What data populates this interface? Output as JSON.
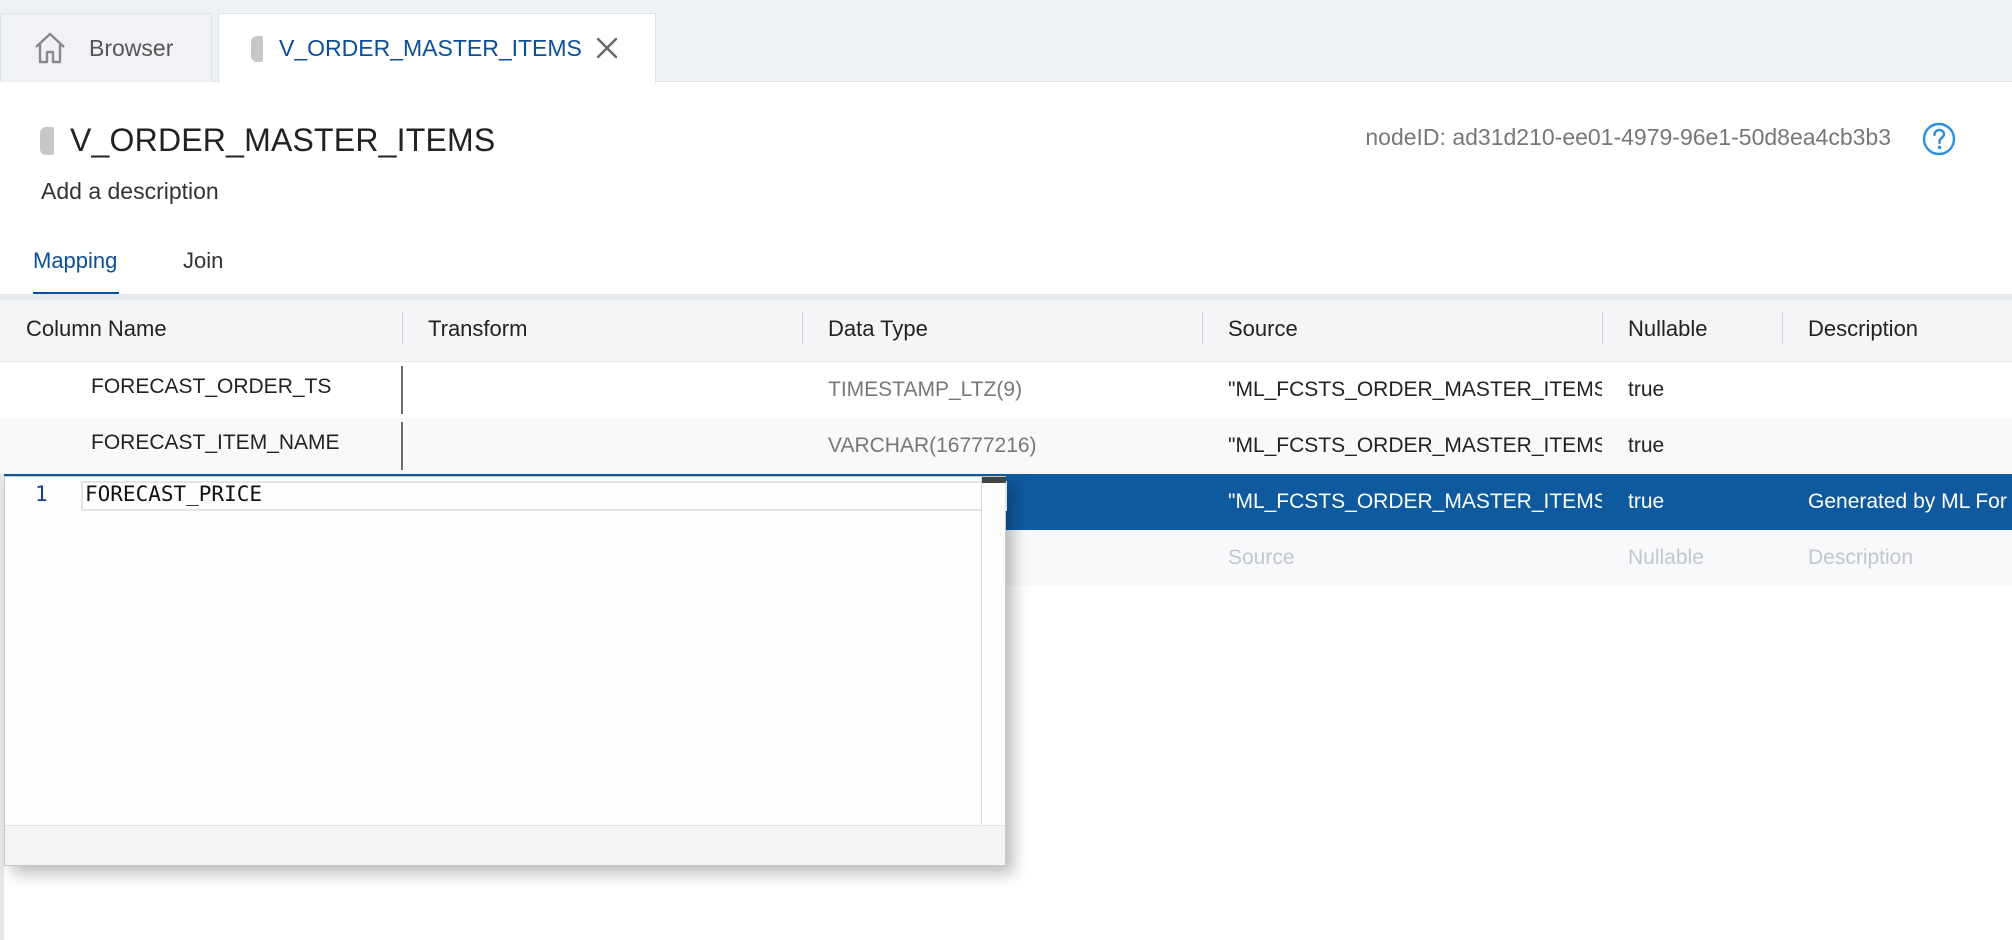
{
  "tabs": {
    "browser": {
      "label": "Browser",
      "icon": "home-icon"
    },
    "active": {
      "label": "V_ORDER_MASTER_ITEMS",
      "icon": "node-icon",
      "close_icon": "close-icon"
    }
  },
  "header": {
    "title": "V_ORDER_MASTER_ITEMS",
    "node_id": "nodeID: ad31d210-ee01-4979-96e1-50d8ea4cb3b3",
    "description_placeholder": "Add a description",
    "help_icon": "help-icon"
  },
  "subtabs": [
    {
      "label": "Mapping",
      "active": true
    },
    {
      "label": "Join",
      "active": false
    }
  ],
  "grid": {
    "columns": [
      "Column Name",
      "Transform",
      "Data Type",
      "Source",
      "Nullable",
      "Description"
    ],
    "rows": [
      {
        "name": "FORECAST_ORDER_TS",
        "transform": "",
        "data_type": "TIMESTAMP_LTZ(9)",
        "source": "\"ML_FCSTS_ORDER_MASTER_ITEMS\".",
        "nullable": "true",
        "description": ""
      },
      {
        "name": "FORECAST_ITEM_NAME",
        "transform": "",
        "data_type": "VARCHAR(16777216)",
        "source": "\"ML_FCSTS_ORDER_MASTER_ITEMS\".",
        "nullable": "true",
        "description": ""
      },
      {
        "name": "",
        "transform": "",
        "data_type": "",
        "source": "\"ML_FCSTS_ORDER_MASTER_ITEMS\".",
        "nullable": "true",
        "description": "Generated by ML For",
        "selected": true
      }
    ],
    "new_row_placeholders": {
      "source": "Source",
      "nullable": "Nullable",
      "description": "Description"
    }
  },
  "editor": {
    "line_number": "1",
    "text": "FORECAST_PRICE"
  },
  "colors": {
    "accent": "#0b4f9b",
    "selected_row": "#0f5a9e",
    "help_icon": "#2a8fe0"
  }
}
